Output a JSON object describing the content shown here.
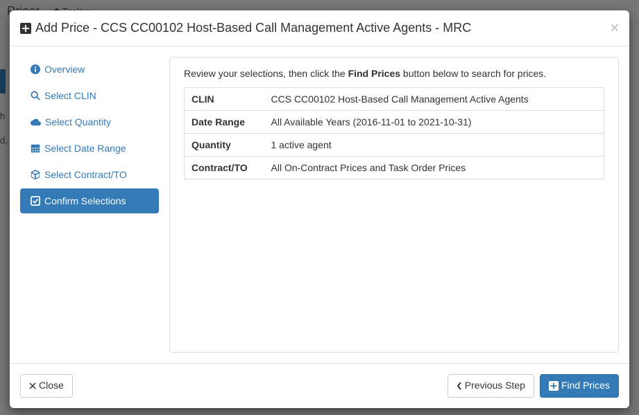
{
  "background": {
    "app_title": "Pricer",
    "tools_label": "Tools",
    "fragment_h": "h",
    "fragment_d": "d,"
  },
  "modal": {
    "title": "Add Price - CCS CC00102 Host-Based Call Management Active Agents - MRC",
    "close_x": "×"
  },
  "nav": {
    "overview": "Overview",
    "select_clin": "Select CLIN",
    "select_quantity": "Select Quantity",
    "select_date_range": "Select Date Range",
    "select_contract_to": "Select Contract/TO",
    "confirm_selections": "Confirm Selections"
  },
  "content": {
    "intro_prefix": "Review your selections, then click the ",
    "intro_bold": "Find Prices",
    "intro_suffix": " button below to search for prices.",
    "rows": {
      "clin": {
        "label": "CLIN",
        "value": "CCS CC00102 Host-Based Call Management Active Agents"
      },
      "date_range": {
        "label": "Date Range",
        "value": "All Available Years (2016-11-01 to 2021-10-31)"
      },
      "quantity": {
        "label": "Quantity",
        "value": "1 active agent"
      },
      "contract_to": {
        "label": "Contract/TO",
        "value": "All On-Contract Prices and Task Order Prices"
      }
    }
  },
  "footer": {
    "close": "Close",
    "previous_step": "Previous Step",
    "find_prices": "Find Prices"
  }
}
